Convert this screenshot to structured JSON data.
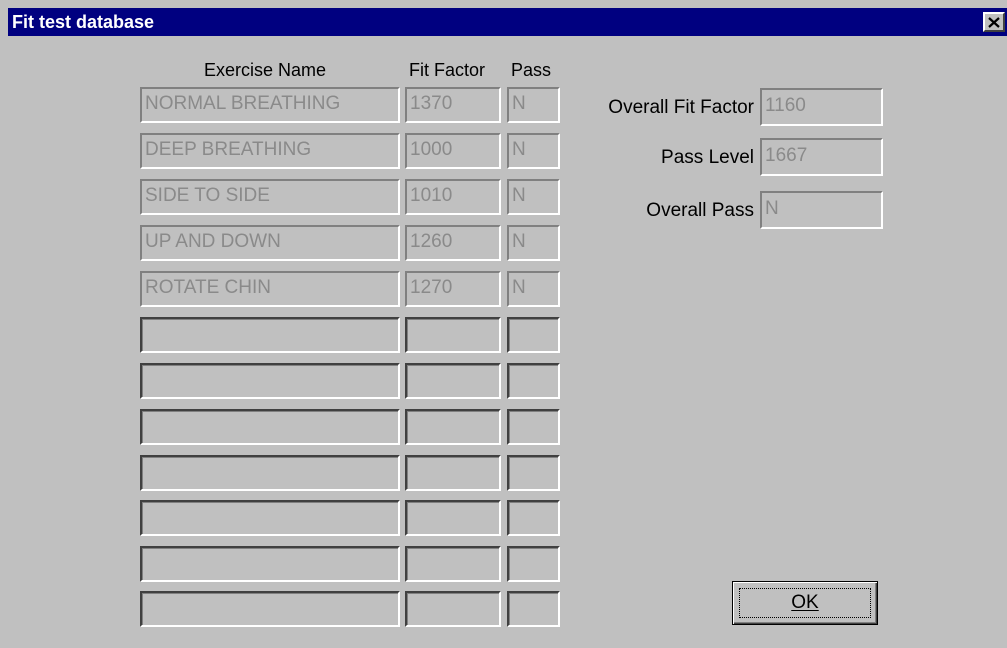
{
  "window": {
    "title": "Fit test database",
    "close_glyph": "×"
  },
  "table": {
    "headers": {
      "exercise": "Exercise Name",
      "fit_factor": "Fit Factor",
      "pass": "Pass"
    },
    "rows": [
      {
        "exercise": "NORMAL BREATHING",
        "fit_factor": "1370",
        "pass": "N"
      },
      {
        "exercise": "DEEP BREATHING",
        "fit_factor": "1000",
        "pass": "N"
      },
      {
        "exercise": "SIDE TO SIDE",
        "fit_factor": "1010",
        "pass": "N"
      },
      {
        "exercise": "UP AND DOWN",
        "fit_factor": "1260",
        "pass": "N"
      },
      {
        "exercise": "ROTATE CHIN",
        "fit_factor": "1270",
        "pass": "N"
      },
      {
        "exercise": "",
        "fit_factor": "",
        "pass": ""
      },
      {
        "exercise": "",
        "fit_factor": "",
        "pass": ""
      },
      {
        "exercise": "",
        "fit_factor": "",
        "pass": ""
      },
      {
        "exercise": "",
        "fit_factor": "",
        "pass": ""
      },
      {
        "exercise": "",
        "fit_factor": "",
        "pass": ""
      },
      {
        "exercise": "",
        "fit_factor": "",
        "pass": ""
      },
      {
        "exercise": "",
        "fit_factor": "",
        "pass": ""
      }
    ]
  },
  "summary": {
    "overall_fit_factor_label": "Overall Fit Factor",
    "overall_fit_factor_value": "1160",
    "pass_level_label": "Pass Level",
    "pass_level_value": "1667",
    "overall_pass_label": "Overall Pass",
    "overall_pass_value": "N"
  },
  "buttons": {
    "ok_label": "OK"
  },
  "colors": {
    "titlebar": "#000080",
    "face": "#c0c0c0",
    "disabled_text": "#8a8a8a"
  }
}
